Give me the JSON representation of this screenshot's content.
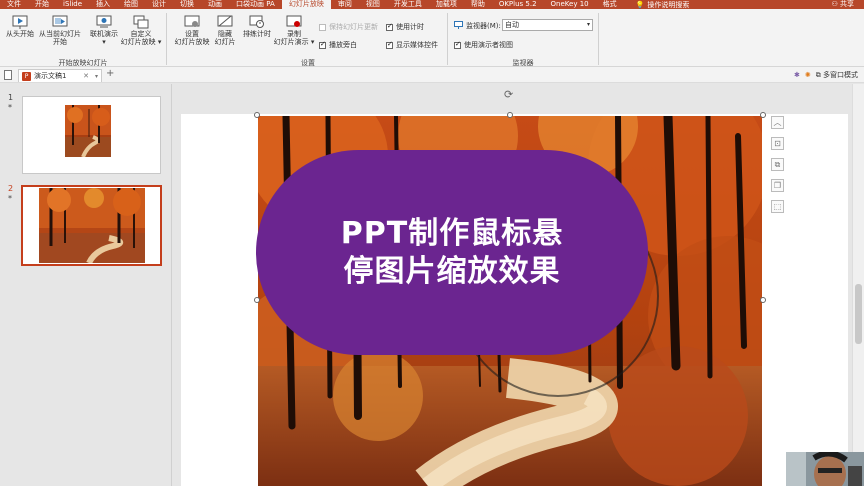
{
  "tabs": [
    {
      "label": "文件"
    },
    {
      "label": "开始"
    },
    {
      "label": "iSlide"
    },
    {
      "label": "插入"
    },
    {
      "label": "绘图"
    },
    {
      "label": "设计"
    },
    {
      "label": "切换"
    },
    {
      "label": "动画"
    },
    {
      "label": "口袋动画 PA"
    },
    {
      "label": "幻灯片放映"
    },
    {
      "label": "审阅"
    },
    {
      "label": "视图"
    },
    {
      "label": "开发工具"
    },
    {
      "label": "加载项"
    },
    {
      "label": "帮助"
    },
    {
      "label": "OKPlus 5.2"
    },
    {
      "label": "OneKey 10"
    },
    {
      "label": "格式"
    }
  ],
  "tell_me": "操作说明搜索",
  "share": "共享",
  "ribbon": {
    "start_group": {
      "from_start": "从头开始",
      "from_current_1": "从当前幻灯片",
      "from_current_2": "开始",
      "online_1": "联机演示",
      "online_2": "▾",
      "custom_1": "自定义",
      "custom_2": "幻灯片放映 ▾",
      "label": "开始放映幻灯片"
    },
    "setup_group": {
      "setup_1": "设置",
      "setup_2": "幻灯片放映",
      "hide_1": "隐藏",
      "hide_2": "幻灯片",
      "rehearse": "排练计时",
      "record_1": "录制",
      "record_2": "幻灯片演示 ▾",
      "keep_updated": "保持幻灯片更新",
      "play_narration": "播放旁白",
      "use_timings": "使用计时",
      "show_media": "显示媒体控件",
      "label": "设置"
    },
    "monitor_group": {
      "monitor_label": "监视器(M):",
      "monitor_value": "自动",
      "presenter_view": "使用演示者视图",
      "label": "监视器"
    }
  },
  "doc_tab": {
    "name": "演示文稿1"
  },
  "right_tools": {
    "multi_window": "多窗口模式"
  },
  "slides": [
    {
      "number": "1",
      "star": "*"
    },
    {
      "number": "2",
      "star": "*"
    }
  ],
  "slide_text": {
    "line1": "PPT制作鼠标悬",
    "line2": "停图片缩放效果"
  },
  "colors": {
    "accent": "#b7472a",
    "shape_fill": "#6b2590"
  }
}
